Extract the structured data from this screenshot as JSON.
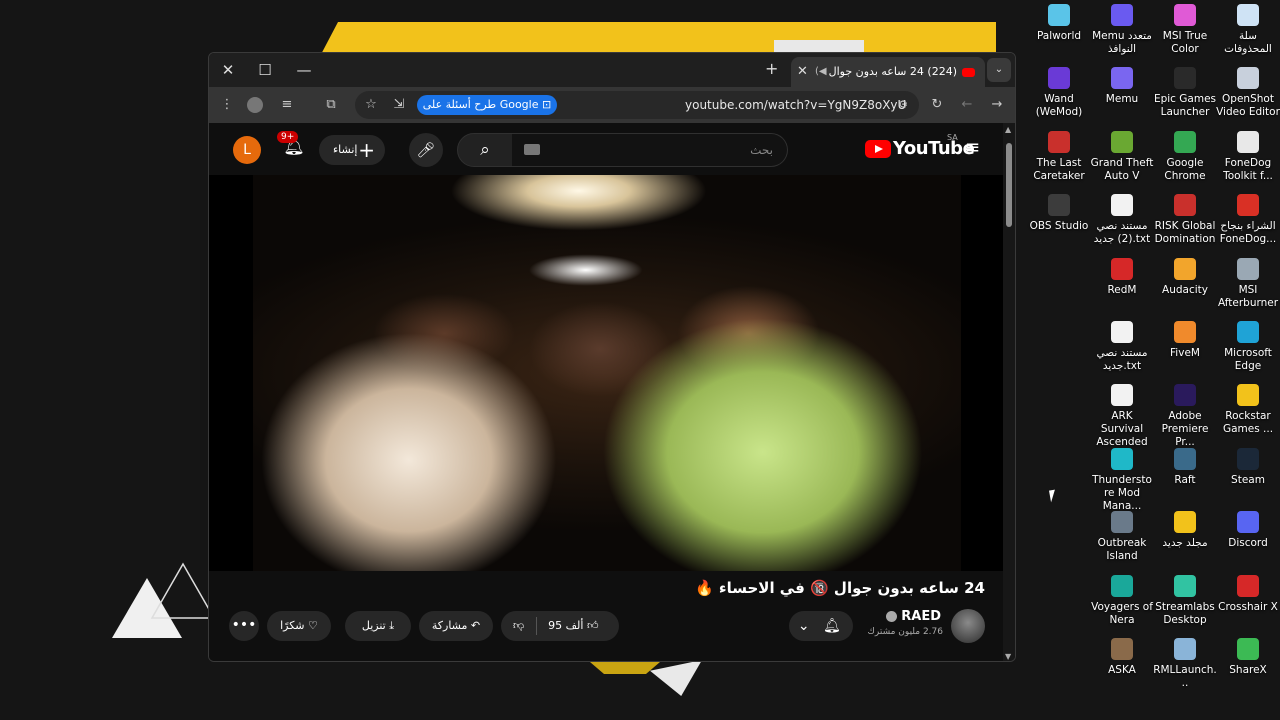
{
  "window": {
    "tab_title": "(224) 24 ساعه بدون جوال",
    "url": "youtube.com/watch?v=YgN9Z8oXyU",
    "gemini_label": "طرح أسئلة على Google"
  },
  "youtube": {
    "logo_text": "YouTube",
    "country_code": "SA",
    "search_placeholder": "بحث",
    "create_label": "إنشاء",
    "notif_badge": "9+",
    "avatar_letter": "L",
    "video_title": "24 ساعه بدون جوال 🔞 في الاحساء 🔥",
    "channel_name": "RAED",
    "subscribers": "2.76 مليون مشترك",
    "likes": "95 ألف",
    "share_label": "مشاركة",
    "download_label": "تنزيل",
    "thanks_label": "شكرًا"
  },
  "desktop_icons": [
    {
      "label": "سلة المحذوفات",
      "icon": "recycle-bin-icon",
      "color": "#cfe3f5"
    },
    {
      "label": "MSI True Color",
      "icon": "msi-true-color-icon",
      "color": "#e05ad6"
    },
    {
      "label": "Memu متعدد النوافذ",
      "icon": "memu-multi-icon",
      "color": "#6a5af0"
    },
    {
      "label": "Palworld",
      "icon": "palworld-icon",
      "color": "#5ac4e8"
    },
    {
      "label": "OpenShot Video Editor",
      "icon": "openshot-icon",
      "color": "#c8d0dc"
    },
    {
      "label": "Epic Games Launcher",
      "icon": "epic-games-icon",
      "color": "#2a2a2a"
    },
    {
      "label": "Memu",
      "icon": "memu-icon",
      "color": "#7a66f0"
    },
    {
      "label": "Wand (WeMod)",
      "icon": "wand-icon",
      "color": "#6a3ad6"
    },
    {
      "label": "FoneDog Toolkit f...",
      "icon": "fonedog-icon",
      "color": "#e8e8e8"
    },
    {
      "label": "Google Chrome",
      "icon": "chrome-icon",
      "color": "#34a853"
    },
    {
      "label": "Grand Theft Auto V",
      "icon": "gta-icon",
      "color": "#6aa832"
    },
    {
      "label": "The Last Caretaker",
      "icon": "last-caretaker-icon",
      "color": "#c9302c"
    },
    {
      "label": "الشراء بنجاح FoneDog...",
      "icon": "pdf-icon",
      "color": "#d93025"
    },
    {
      "label": "RISK Global Domination",
      "icon": "risk-icon",
      "color": "#c9302c"
    },
    {
      "label": "مستند نصي (2) جديد.txt",
      "icon": "text-file-icon",
      "color": "#f2f2f2"
    },
    {
      "label": "OBS Studio",
      "icon": "obs-icon",
      "color": "#3c3c3c"
    },
    {
      "label": "MSI Afterburner",
      "icon": "afterburner-icon",
      "color": "#9aa8b4"
    },
    {
      "label": "Audacity",
      "icon": "audacity-icon",
      "color": "#f2a52c"
    },
    {
      "label": "RedM",
      "icon": "redm-icon",
      "color": "#d62828"
    },
    {
      "label": "Microsoft Edge",
      "icon": "edge-icon",
      "color": "#1fa3d6"
    },
    {
      "label": "FiveM",
      "icon": "fivem-icon",
      "color": "#f08a2c"
    },
    {
      "label": "مستند نصي جديد.txt",
      "icon": "text-file-icon",
      "color": "#f2f2f2"
    },
    {
      "label": "Rockstar Games ...",
      "icon": "rockstar-icon",
      "color": "#f2c21b"
    },
    {
      "label": "Adobe Premiere Pr...",
      "icon": "premiere-icon",
      "color": "#2a1a5c"
    },
    {
      "label": "ARK Survival Ascended",
      "icon": "text-file-icon",
      "color": "#f2f2f2"
    },
    {
      "label": "Steam",
      "icon": "steam-icon",
      "color": "#1b2838"
    },
    {
      "label": "Raft",
      "icon": "raft-icon",
      "color": "#3a6a8a"
    },
    {
      "label": "Thunderstore Mod Mana...",
      "icon": "thunderstore-icon",
      "color": "#1fb8c8"
    },
    {
      "label": "Discord",
      "icon": "discord-icon",
      "color": "#5865f2"
    },
    {
      "label": "مجلد جديد",
      "icon": "folder-icon",
      "color": "#f2c21b"
    },
    {
      "label": "Outbreak Island",
      "icon": "outbreak-icon",
      "color": "#6a7a8a"
    },
    {
      "label": "Crosshair X",
      "icon": "crosshair-icon",
      "color": "#d62828"
    },
    {
      "label": "Streamlabs Desktop",
      "icon": "streamlabs-icon",
      "color": "#31c3a2"
    },
    {
      "label": "Voyagers of Nera",
      "icon": "voyagers-icon",
      "color": "#1aa89a"
    },
    {
      "label": "ShareX",
      "icon": "sharex-icon",
      "color": "#3cba54"
    },
    {
      "label": "RMLLaunch...",
      "icon": "rml-icon",
      "color": "#8ab4d8"
    },
    {
      "label": "ASKA",
      "icon": "aska-icon",
      "color": "#8a6a4a"
    }
  ]
}
